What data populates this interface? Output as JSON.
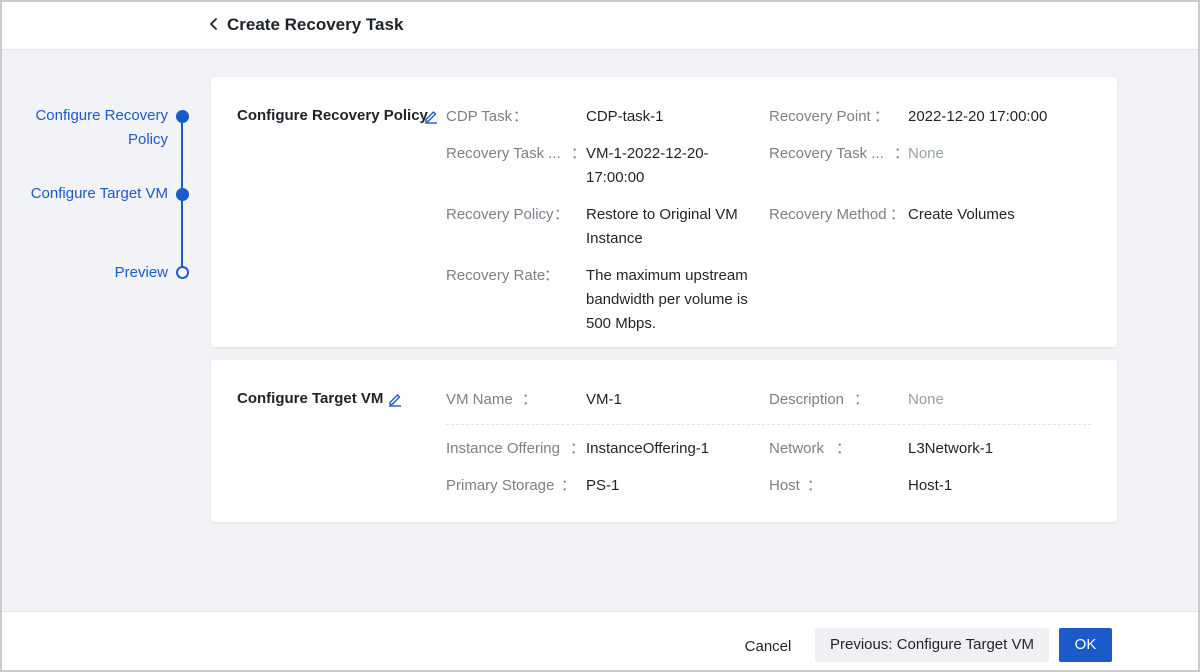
{
  "header": {
    "title": "Create Recovery Task"
  },
  "steps": {
    "step1_line1": "Configure Recovery",
    "step1_line2": "Policy",
    "step2": "Configure Target VM",
    "step3": "Preview"
  },
  "recovery_policy": {
    "title": "Configure Recovery Policy",
    "cdp_task_label": "CDP Task",
    "cdp_task_value": "CDP-task-1",
    "recovery_point_label": "Recovery Point",
    "recovery_point_value": "2022-12-20 17:00:00",
    "recovery_task_name_label": "Recovery Task ...",
    "recovery_task_name_value_line1": "VM-1-2022-12-20-",
    "recovery_task_name_value_line2": "17:00:00",
    "recovery_task_desc_label": "Recovery Task ...",
    "recovery_task_desc_value": "None",
    "recovery_policy_label": "Recovery Policy",
    "recovery_policy_value_line1": "Restore to Original VM",
    "recovery_policy_value_line2": "Instance",
    "recovery_method_label": "Recovery Method",
    "recovery_method_value": "Create Volumes",
    "recovery_rate_label": "Recovery Rate",
    "recovery_rate_value_line1": "The maximum upstream",
    "recovery_rate_value_line2": "bandwidth per volume is",
    "recovery_rate_value_line3": "500 Mbps."
  },
  "target_vm": {
    "title": "Configure Target VM",
    "vm_name_label": "VM Name",
    "vm_name_value": "VM-1",
    "description_label": "Description",
    "description_value": "None",
    "instance_offering_label": "Instance Offering",
    "instance_offering_value": "InstanceOffering-1",
    "network_label": "Network",
    "network_value": "L3Network-1",
    "primary_storage_label": "Primary Storage",
    "primary_storage_value": "PS-1",
    "host_label": "Host",
    "host_value": "Host-1"
  },
  "colon": "：",
  "footer": {
    "cancel": "Cancel",
    "previous": "Previous: Configure Target VM",
    "ok": "OK"
  },
  "colors": {
    "accent": "#1a5ac9",
    "background": "#f1f3f6",
    "label": "#7b8089",
    "value": "#1f2329"
  },
  "icons": {
    "back": "chevron-left-icon",
    "edit": "pencil-edit-icon"
  }
}
